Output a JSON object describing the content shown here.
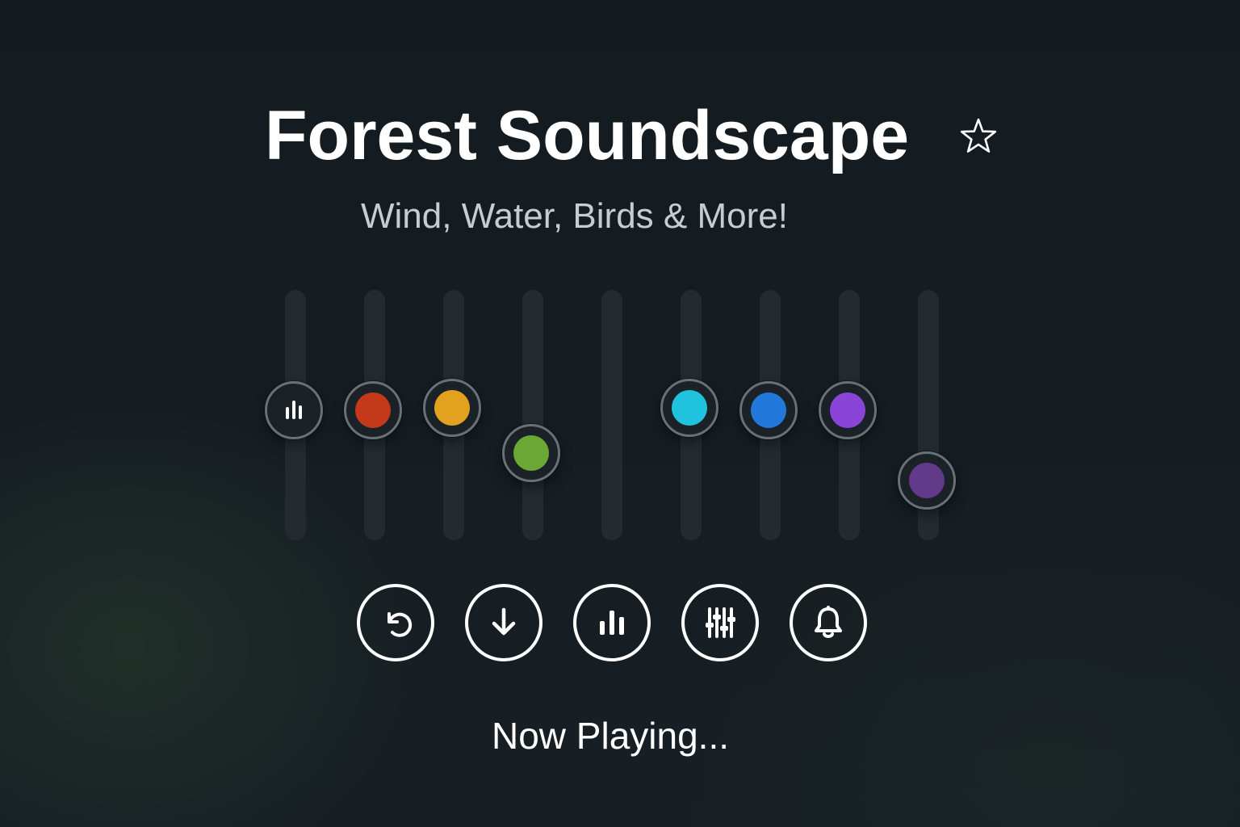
{
  "header": {
    "title": "Forest Soundscape",
    "subtitle": "Wind, Water, Birds & More!",
    "favorite_icon": "star-outline-icon"
  },
  "mixer": {
    "channels": [
      {
        "id": "ch1",
        "knob": "equalizer-icon",
        "color": null,
        "level": 0.52
      },
      {
        "id": "ch2",
        "knob": "color-dot",
        "color": "#c5391b",
        "level": 0.52
      },
      {
        "id": "ch3",
        "knob": "color-dot",
        "color": "#e2a11f",
        "level": 0.53
      },
      {
        "id": "ch4",
        "knob": "color-dot",
        "color": "#6aa734",
        "level": 0.35
      },
      {
        "id": "ch5",
        "knob": "none",
        "color": null,
        "level": null
      },
      {
        "id": "ch6",
        "knob": "color-dot",
        "color": "#1fc3dd",
        "level": 0.53
      },
      {
        "id": "ch7",
        "knob": "color-dot",
        "color": "#2379d9",
        "level": 0.52
      },
      {
        "id": "ch8",
        "knob": "color-dot",
        "color": "#8a45d8",
        "level": 0.52
      },
      {
        "id": "ch9",
        "knob": "color-dot",
        "color": "#633a8a",
        "level": 0.24
      }
    ]
  },
  "controls": [
    {
      "id": "reset",
      "icon": "undo-arrow-icon"
    },
    {
      "id": "download",
      "icon": "download-arrow-icon"
    },
    {
      "id": "levels",
      "icon": "bar-chart-icon"
    },
    {
      "id": "mixer",
      "icon": "sliders-icon"
    },
    {
      "id": "alarm",
      "icon": "bell-icon"
    }
  ],
  "status": {
    "text": "Now Playing..."
  },
  "colors": {
    "background": "#161d22",
    "track": "#232b31",
    "knob_ring": "#6a7176",
    "text_primary": "#ffffff",
    "text_secondary": "#c7ccd0"
  }
}
